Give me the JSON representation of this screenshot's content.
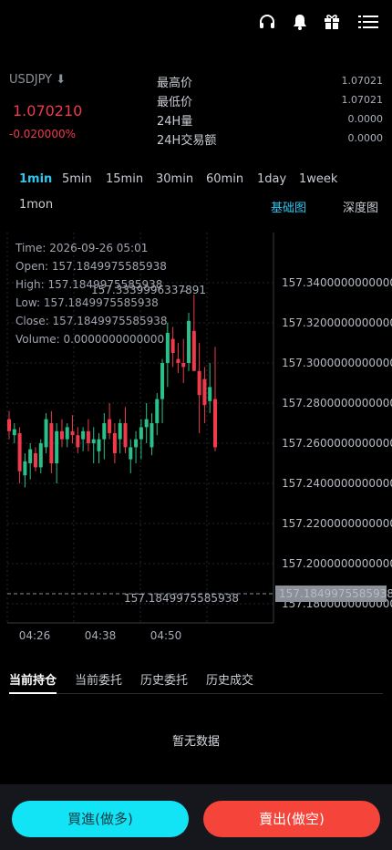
{
  "header": {
    "icons": [
      "headset-icon",
      "bell-icon",
      "gift-icon",
      "menu-icon"
    ]
  },
  "ticker": {
    "symbol": "USDJPY ⬇",
    "price": "1.070210",
    "change": "-0.020000%",
    "stats": [
      {
        "label": "最高价",
        "value": "1.07021"
      },
      {
        "label": "最低价",
        "value": "1.07021"
      },
      {
        "label": "24H量",
        "value": "0.0000"
      },
      {
        "label": "24H交易额",
        "value": "0.0000"
      }
    ]
  },
  "timeframes": [
    "1min",
    "5min",
    "15min",
    "30min",
    "60min",
    "1day",
    "1week",
    "1mon"
  ],
  "views": {
    "basic": "基础图",
    "depth": "深度图"
  },
  "chart_info": {
    "time": "Time: 2026-09-26 05:01",
    "open": "Open: 157.1849975585938",
    "high": "High: 157.1849975585938",
    "low": "Low: 157.1849975585938",
    "close": "Close: 157.1849975585938",
    "volume": "Volume: 0.0000000000000"
  },
  "chart_data": {
    "type": "candlestick",
    "y_ticks": [
      "157.3400000000000",
      "157.3200000000000",
      "157.3000000000000",
      "157.2800000000000",
      "157.2600000000000",
      "157.2400000000000",
      "157.2200000000000",
      "157.2000000000000",
      "157.1800000000000"
    ],
    "ylim": [
      157.18,
      157.34
    ],
    "x_ticks": [
      "04:26",
      "04:38",
      "04:50"
    ],
    "current_price_label": "157.1849975585938",
    "high_marker_label": "157.3339996337891",
    "last_price_line_label": "157.1849975585938",
    "colors": {
      "up": "#2bc08a",
      "down": "#ee3a4a"
    },
    "candles": [
      {
        "o": 157.272,
        "h": 157.276,
        "l": 157.262,
        "c": 157.266
      },
      {
        "o": 157.264,
        "h": 157.27,
        "l": 157.26,
        "c": 157.267
      },
      {
        "o": 157.265,
        "h": 157.268,
        "l": 157.24,
        "c": 157.246
      },
      {
        "o": 157.244,
        "h": 157.255,
        "l": 157.238,
        "c": 157.251
      },
      {
        "o": 157.25,
        "h": 157.26,
        "l": 157.242,
        "c": 157.257
      },
      {
        "o": 157.255,
        "h": 157.258,
        "l": 157.246,
        "c": 157.248
      },
      {
        "o": 157.248,
        "h": 157.262,
        "l": 157.245,
        "c": 157.26
      },
      {
        "o": 157.258,
        "h": 157.275,
        "l": 157.255,
        "c": 157.272
      },
      {
        "o": 157.27,
        "h": 157.276,
        "l": 157.245,
        "c": 157.25
      },
      {
        "o": 157.25,
        "h": 157.27,
        "l": 157.24,
        "c": 157.266
      },
      {
        "o": 157.266,
        "h": 157.272,
        "l": 157.258,
        "c": 157.262
      },
      {
        "o": 157.262,
        "h": 157.27,
        "l": 157.258,
        "c": 157.268
      },
      {
        "o": 157.266,
        "h": 157.274,
        "l": 157.26,
        "c": 157.264
      },
      {
        "o": 157.264,
        "h": 157.268,
        "l": 157.255,
        "c": 157.258
      },
      {
        "o": 157.262,
        "h": 157.268,
        "l": 157.256,
        "c": 157.266
      },
      {
        "o": 157.266,
        "h": 157.272,
        "l": 157.256,
        "c": 157.26
      },
      {
        "o": 157.26,
        "h": 157.268,
        "l": 157.25,
        "c": 157.262
      },
      {
        "o": 157.256,
        "h": 157.265,
        "l": 157.25,
        "c": 157.262
      },
      {
        "o": 157.262,
        "h": 157.275,
        "l": 157.252,
        "c": 157.27
      },
      {
        "o": 157.272,
        "h": 157.28,
        "l": 157.262,
        "c": 157.265
      },
      {
        "o": 157.265,
        "h": 157.27,
        "l": 157.25,
        "c": 157.255
      },
      {
        "o": 157.262,
        "h": 157.272,
        "l": 157.255,
        "c": 157.27
      },
      {
        "o": 157.27,
        "h": 157.278,
        "l": 157.255,
        "c": 157.258
      },
      {
        "o": 157.252,
        "h": 157.262,
        "l": 157.245,
        "c": 157.258
      },
      {
        "o": 157.258,
        "h": 157.266,
        "l": 157.25,
        "c": 157.262
      },
      {
        "o": 157.262,
        "h": 157.272,
        "l": 157.252,
        "c": 157.268
      },
      {
        "o": 157.268,
        "h": 157.28,
        "l": 157.26,
        "c": 157.272
      },
      {
        "o": 157.258,
        "h": 157.275,
        "l": 157.254,
        "c": 157.27
      },
      {
        "o": 157.27,
        "h": 157.285,
        "l": 157.264,
        "c": 157.282
      },
      {
        "o": 157.282,
        "h": 157.302,
        "l": 157.27,
        "c": 157.3
      },
      {
        "o": 157.3,
        "h": 157.32,
        "l": 157.288,
        "c": 157.315
      },
      {
        "o": 157.312,
        "h": 157.318,
        "l": 157.298,
        "c": 157.305
      },
      {
        "o": 157.302,
        "h": 157.31,
        "l": 157.295,
        "c": 157.3
      },
      {
        "o": 157.3,
        "h": 157.312,
        "l": 157.29,
        "c": 157.298
      },
      {
        "o": 157.3,
        "h": 157.325,
        "l": 157.296,
        "c": 157.321
      },
      {
        "o": 157.316,
        "h": 157.334,
        "l": 157.305,
        "c": 157.296
      },
      {
        "o": 157.296,
        "h": 157.31,
        "l": 157.265,
        "c": 157.284
      },
      {
        "o": 157.292,
        "h": 157.298,
        "l": 157.27,
        "c": 157.279
      },
      {
        "o": 157.281,
        "h": 157.3,
        "l": 157.275,
        "c": 157.288
      },
      {
        "o": 157.282,
        "h": 157.308,
        "l": 157.256,
        "c": 157.258
      }
    ]
  },
  "order_tabs": [
    "当前持仓",
    "当前委托",
    "历史委托",
    "历史成交"
  ],
  "empty_text": "暂无数据",
  "footer": {
    "buy": "買進(做多)",
    "sell": "賣出(做空)"
  }
}
